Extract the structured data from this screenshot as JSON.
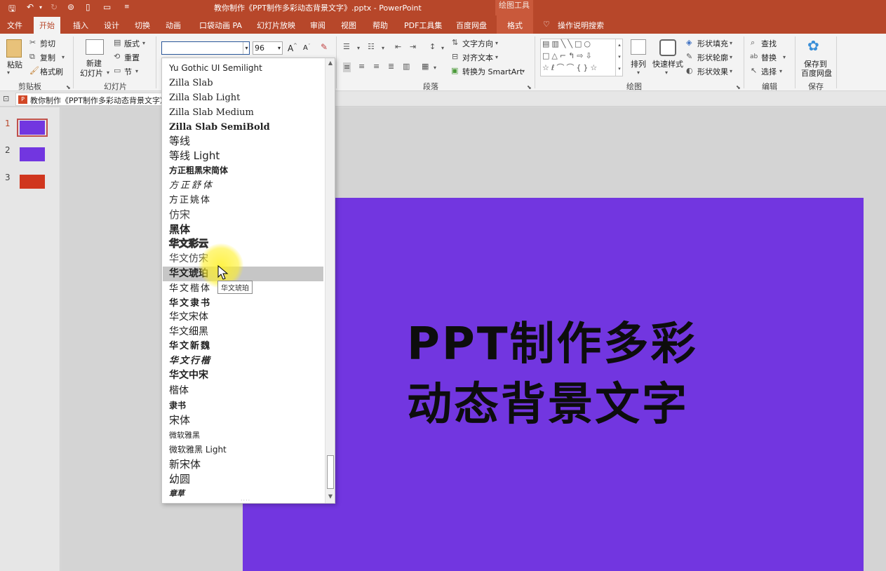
{
  "window": {
    "title": "教你制作《PPT制作多彩动态背景文字》.pptx  -  PowerPoint",
    "context_tab_group": "绘图工具"
  },
  "quick_access": {
    "icons": [
      "save-icon",
      "undo-icon",
      "redo-icon",
      "present-icon",
      "new-icon",
      "open-icon",
      "customize-icon"
    ]
  },
  "tabs": [
    {
      "label": "文件"
    },
    {
      "label": "开始"
    },
    {
      "label": "插入"
    },
    {
      "label": "设计"
    },
    {
      "label": "切换"
    },
    {
      "label": "动画"
    },
    {
      "label": "口袋动画 PA"
    },
    {
      "label": "幻灯片放映"
    },
    {
      "label": "审阅"
    },
    {
      "label": "视图"
    },
    {
      "label": "帮助"
    },
    {
      "label": "PDF工具集"
    },
    {
      "label": "百度网盘"
    },
    {
      "label": "格式"
    },
    {
      "label": "操作说明搜索"
    }
  ],
  "ribbon": {
    "clipboard": {
      "paste": "粘贴",
      "cut": "剪切",
      "copy": "复制",
      "format_painter": "格式刷",
      "group": "剪贴板"
    },
    "slides": {
      "new_slide_1": "新建",
      "new_slide_2": "幻灯片",
      "layout": "版式",
      "reset": "重置",
      "section": "节",
      "group": "幻灯片"
    },
    "font": {
      "name_value": "",
      "size_value": "96",
      "grow": "A",
      "shrink": "A"
    },
    "paragraph": {
      "text_direction": "文字方向",
      "align_text": "对齐文本",
      "smartart": "转换为 SmartArt",
      "group": "段落"
    },
    "drawing": {
      "arrange": "排列",
      "quick_styles": "快速样式",
      "fill": "形状填充",
      "outline": "形状轮廓",
      "effects": "形状效果",
      "group": "绘图"
    },
    "editing": {
      "find": "查找",
      "replace": "替换",
      "select": "选择",
      "group": "编辑"
    },
    "save": {
      "line1": "保存到",
      "line2": "百度网盘",
      "group": "保存"
    }
  },
  "document_tab": {
    "label": "教你制作《PPT制作多彩动态背景文字》"
  },
  "thumbnails": [
    {
      "number": "1",
      "color": "#7236e0",
      "selected": true
    },
    {
      "number": "2",
      "color": "#7236e0",
      "selected": false
    },
    {
      "number": "3",
      "color": "#d0361e",
      "selected": false
    }
  ],
  "slide": {
    "background": "#7236e0",
    "line1": "PPT制作多彩",
    "line2": "动态背景文字"
  },
  "font_dropdown": {
    "items": [
      {
        "label": "Yu Gothic UI Semilight"
      },
      {
        "label": "Zilla Slab"
      },
      {
        "label": "Zilla Slab Light"
      },
      {
        "label": "Zilla Slab Medium"
      },
      {
        "label": "Zilla Slab SemiBold"
      },
      {
        "label": "等线"
      },
      {
        "label": "等线 Light"
      },
      {
        "label": "方正粗黑宋简体"
      },
      {
        "label": "方正舒体"
      },
      {
        "label": "方正姚体"
      },
      {
        "label": "仿宋"
      },
      {
        "label": "黑体"
      },
      {
        "label": "华文彩云"
      },
      {
        "label": "华文仿宋"
      },
      {
        "label": "华文琥珀"
      },
      {
        "label": "华文楷体"
      },
      {
        "label": "华文隶书"
      },
      {
        "label": "华文宋体"
      },
      {
        "label": "华文细黑"
      },
      {
        "label": "华文新魏"
      },
      {
        "label": "华文行楷"
      },
      {
        "label": "华文中宋"
      },
      {
        "label": "楷体"
      },
      {
        "label": "隶书"
      },
      {
        "label": "宋体"
      },
      {
        "label": "微软雅黑"
      },
      {
        "label": "微软雅黑 Light"
      },
      {
        "label": "新宋体"
      },
      {
        "label": "幼圆"
      },
      {
        "label": "章草"
      }
    ],
    "highlighted_index": 14,
    "tooltip": "华文琥珀"
  }
}
